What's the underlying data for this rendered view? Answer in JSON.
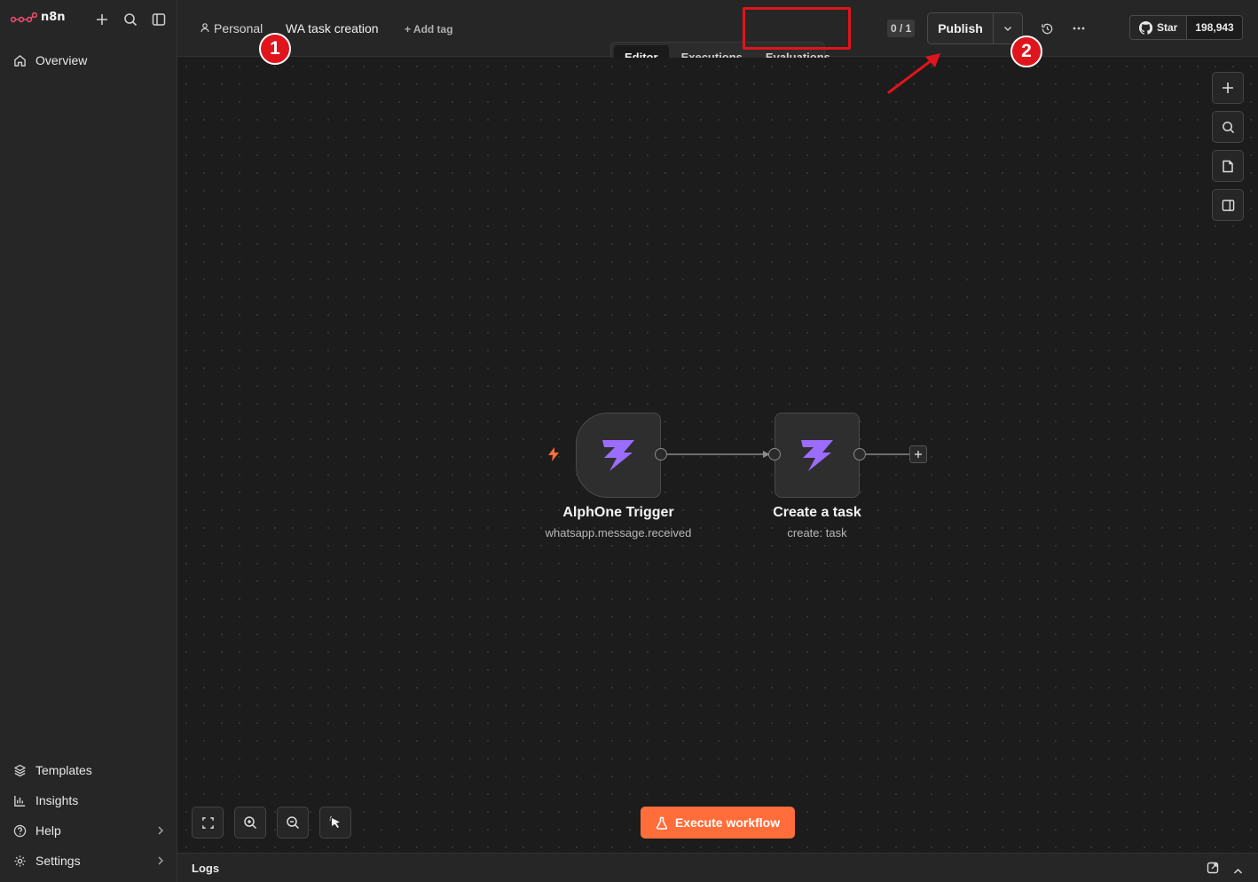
{
  "app": {
    "logo_text": "n8n"
  },
  "sidebar": {
    "overview_label": "Overview",
    "templates_label": "Templates",
    "insights_label": "Insights",
    "help_label": "Help",
    "settings_label": "Settings"
  },
  "header": {
    "project_label": "Personal",
    "workflow_name": "WA task creation",
    "add_tag_label": "+ Add tag",
    "version_counter": "0 / 1",
    "publish_label": "Publish",
    "github_star_label": "Star",
    "github_star_count": "198,943"
  },
  "tabs": [
    {
      "label": "Editor",
      "active": true
    },
    {
      "label": "Executions",
      "active": false
    },
    {
      "label": "Evaluations",
      "active": false
    }
  ],
  "nodes": [
    {
      "title": "AlphOne Trigger",
      "subtitle": "whatsapp.message.received"
    },
    {
      "title": "Create a task",
      "subtitle": "create: task"
    }
  ],
  "canvas": {
    "execute_label": "Execute workflow"
  },
  "logs": {
    "label": "Logs"
  },
  "annotations": [
    {
      "number": "1"
    },
    {
      "number": "2"
    }
  ],
  "colors": {
    "accent": "#ff6d3a",
    "highlight": "#e0141c",
    "node_icon": "#9b6dff",
    "logo": "#ea4b71"
  }
}
